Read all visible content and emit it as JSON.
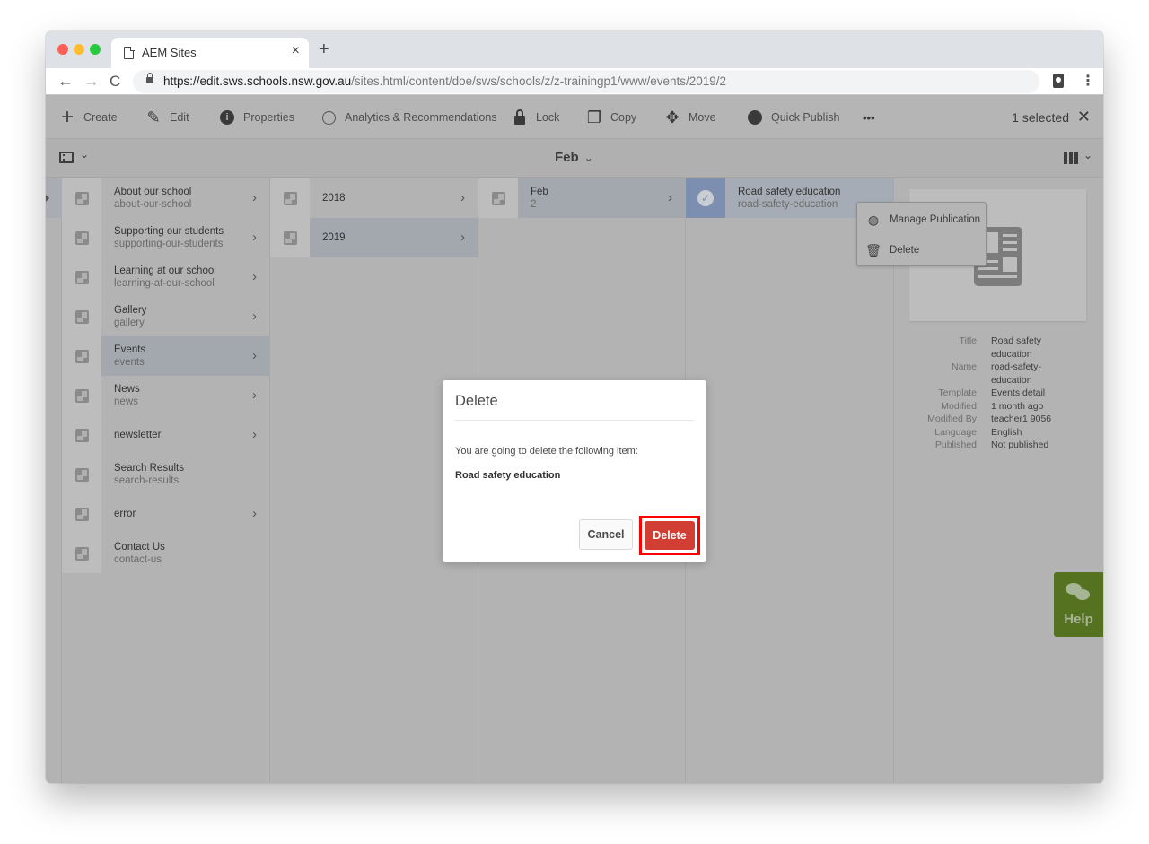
{
  "browser": {
    "tab_title": "AEM Sites",
    "tab_close": "×",
    "new_tab": "+",
    "back": "←",
    "forward": "→",
    "reload": "C",
    "url_host": "https://edit.sws.schools.nsw.gov.au",
    "url_path": "/sites.html/content/doe/sws/schools/z/z-trainingp1/www/events/2019/2",
    "menu": "⋮"
  },
  "actionbar": {
    "items": [
      {
        "label": "Create",
        "icon": "plus-icon",
        "glyph": "+"
      },
      {
        "label": "Edit",
        "icon": "pencil-icon",
        "glyph": "✎"
      },
      {
        "label": "Properties",
        "icon": "info-icon",
        "glyph": "ℹ"
      },
      {
        "label": "Analytics & Recommendations",
        "icon": "analytics-icon",
        "glyph": "◎"
      },
      {
        "label": "Lock",
        "icon": "lock-icon",
        "glyph": "🔒"
      },
      {
        "label": "Copy",
        "icon": "copy-icon",
        "glyph": "❐"
      },
      {
        "label": "Move",
        "icon": "move-icon",
        "glyph": "✥"
      },
      {
        "label": "Quick Publish",
        "icon": "globe-icon",
        "glyph": "◍"
      }
    ],
    "more": "•••",
    "selected_count": "1 selected",
    "clear_selection": "✕"
  },
  "subbar": {
    "breadcrumb": "Feb",
    "breadcrumb_chevron": "⌄",
    "rail_chevron": "⌄",
    "view_chevron": "⌄"
  },
  "columns": {
    "col1": [
      {
        "title": "About our school",
        "name": "about-our-school",
        "has_children": true
      },
      {
        "title": "Supporting our students",
        "name": "supporting-our-students",
        "has_children": true
      },
      {
        "title": "Learning at our school",
        "name": "learning-at-our-school",
        "has_children": true
      },
      {
        "title": "Gallery",
        "name": "gallery",
        "has_children": true
      },
      {
        "title": "Events",
        "name": "events",
        "has_children": true,
        "active": true
      },
      {
        "title": "News",
        "name": "news",
        "has_children": true
      },
      {
        "title": "newsletter",
        "name": "",
        "has_children": true
      },
      {
        "title": "Search Results",
        "name": "search-results",
        "has_children": false
      },
      {
        "title": "error",
        "name": "",
        "has_children": true
      },
      {
        "title": "Contact Us",
        "name": "contact-us",
        "has_children": false
      }
    ],
    "col2": [
      {
        "title": "2018",
        "name": "",
        "has_children": true
      },
      {
        "title": "2019",
        "name": "",
        "has_children": true,
        "active": true
      }
    ],
    "col3": [
      {
        "title": "Feb",
        "name": "2",
        "has_children": true,
        "active": true
      }
    ],
    "col4": [
      {
        "title": "Road safety education",
        "name": "road-safety-education",
        "selected": true
      }
    ],
    "chevron": "›"
  },
  "popover": {
    "items": [
      {
        "label": "Manage Publication",
        "icon": "manage-publication-icon",
        "glyph": "◍"
      },
      {
        "label": "Delete",
        "icon": "trash-icon",
        "glyph": "🗑"
      }
    ]
  },
  "preview": {
    "meta": [
      {
        "key": "Title",
        "value": "Road safety education"
      },
      {
        "key": "Name",
        "value": "road-safety-education"
      },
      {
        "key": "Template",
        "value": "Events detail"
      },
      {
        "key": "Modified",
        "value": "1 month ago"
      },
      {
        "key": "Modified By",
        "value": "teacher1 9056"
      },
      {
        "key": "Language",
        "value": "English"
      },
      {
        "key": "Published",
        "value": "Not published"
      }
    ]
  },
  "help": {
    "label": "Help"
  },
  "dialog": {
    "title": "Delete",
    "message": "You are going to delete the following item:",
    "item": "Road safety education",
    "cancel_label": "Cancel",
    "delete_label": "Delete"
  },
  "colors": {
    "delete_button": "#d03e34",
    "highlight_outline": "#ff0000",
    "help_button": "#557221",
    "selected_thumb": "#7d8fb0"
  }
}
